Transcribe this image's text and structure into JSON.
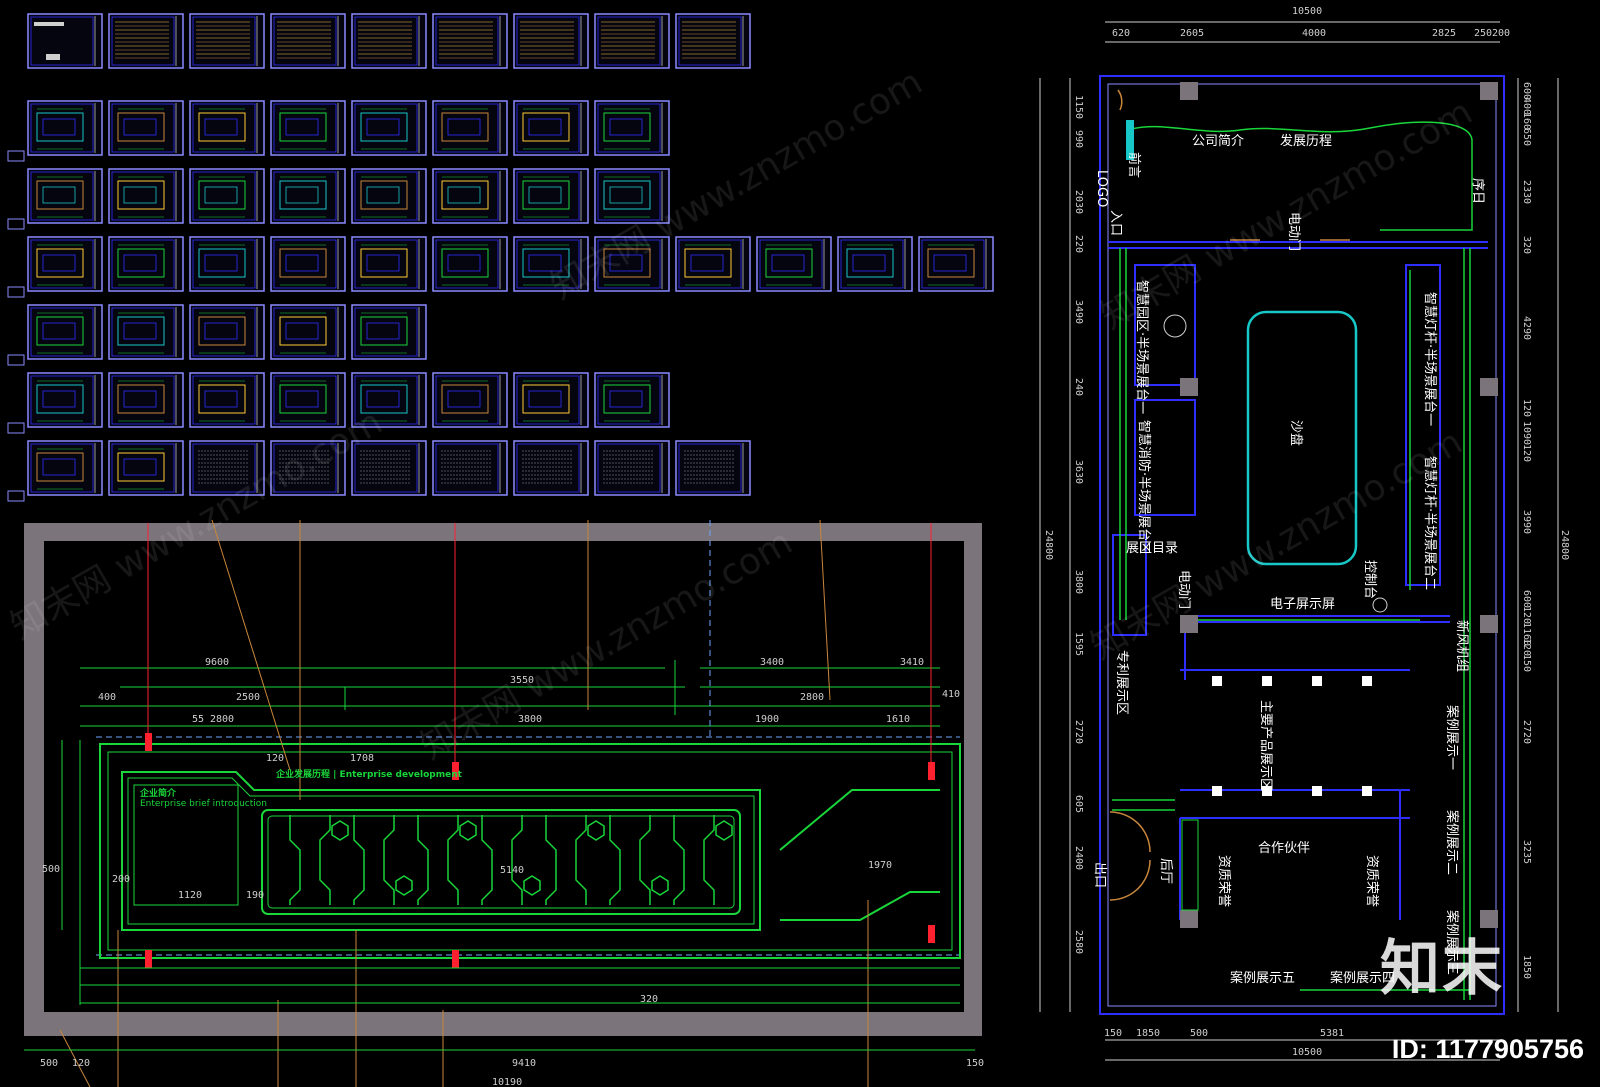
{
  "drawing": {
    "colors": {
      "wall": "#2e2eff",
      "green": "#19d63a",
      "cyan": "#18c7c7",
      "red": "#ff2030",
      "grey": "#7b747b",
      "orange": "#c8863a",
      "frame": "#8a8aff"
    },
    "sheet_rows": [
      9,
      8,
      8,
      12,
      5,
      8,
      9
    ]
  },
  "left_plan": {
    "dims": {
      "top_1": "9600",
      "top_2": "3550",
      "top_3": "3400",
      "top_4": "3410",
      "r2_1": "400",
      "r2_2": "2500",
      "r2_3": "2800",
      "r2_4": "410",
      "r3_1": "55",
      "r3_2": "2800",
      "r3_3": "3800",
      "r3_4": "1900",
      "r3_5": "1610",
      "d_120": "120",
      "d_1708": "1708",
      "d_1120": "1120",
      "d_190": "190",
      "d_5140": "5140",
      "d_1970": "1970",
      "d_500": "500",
      "d_200": "200",
      "d_320": "320",
      "bot_500": "500",
      "bot_120": "120",
      "bot_9410": "9410",
      "bot_150": "150",
      "bot_total": "10190"
    },
    "panel_title_1": "企业简介",
    "panel_sub_1": "Enterprise brief introduction",
    "panel_title_2": "企业发展历程 | Enterprise development"
  },
  "right_plan": {
    "top_total": "10500",
    "top_dims": [
      "620",
      "2605",
      "4000",
      "2825",
      "250",
      "200"
    ],
    "left_dims": [
      "1150",
      "990",
      "2030",
      "220",
      "3490",
      "240",
      "3630",
      "3800",
      "1595",
      "2720",
      "605",
      "2400",
      "2580"
    ],
    "left_total": "24800",
    "right_dims": [
      "600",
      "400",
      "160",
      "650",
      "2330",
      "320",
      "4290",
      "120",
      "1090",
      "120",
      "3990",
      "600",
      "120",
      "1160",
      "120",
      "150",
      "2720",
      "3235",
      "1850"
    ],
    "right_total": "24800",
    "bottom_dims": [
      "150",
      "1850",
      "500",
      "5381"
    ],
    "bottom_total": "10500",
    "labels": {
      "company_intro": "公司简介",
      "history": "发展历程",
      "logo": "LOGO",
      "entrance": "入口",
      "foreword": "前言",
      "preface": "序日",
      "elevator_door": "电动门",
      "smart_park": "智慧园区·半场景展台一",
      "smart_fire": "智慧消防·半场景展台三",
      "smart_light": "智慧灯杆·半场景展台一",
      "smart_cabin": "智慧灯杆·半场景展台二",
      "sand_table": "沙盘",
      "catalog": "展区目录",
      "control": "控制台",
      "e_screen": "电子屏示屏",
      "elevator_door_2": "电动门",
      "patent": "专利展示区",
      "main_products": "主要产品展示区",
      "case_1": "案例展示一",
      "case_2": "案例展示二",
      "case_3": "案例展示三",
      "new_cabinet": "新风机组",
      "partners": "合作伙伴",
      "honor_1": "资质荣誉",
      "honor_2": "资质荣誉",
      "rear_hall": "后厅",
      "exit": "出口",
      "case_bottom_1": "案例展示五",
      "case_bottom_2": "案例展示四"
    }
  },
  "watermark": {
    "text": "知末网 www.znzmo.com",
    "brand": "知末",
    "image_id": "ID: 1177905756"
  }
}
